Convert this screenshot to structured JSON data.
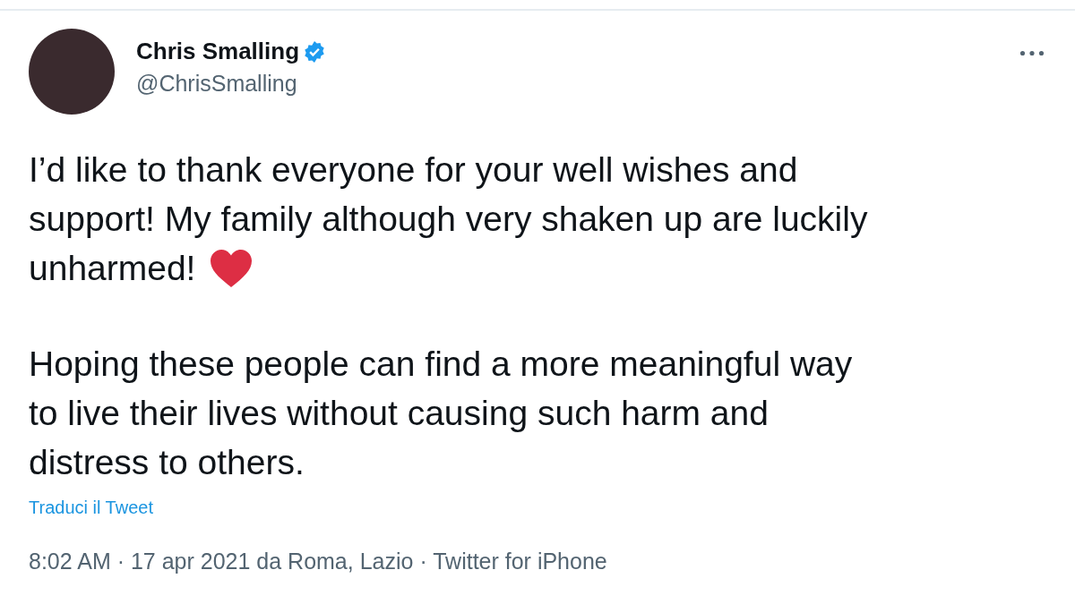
{
  "author": {
    "name": "Chris Smalling",
    "verified": true,
    "handle": "@ChrisSmalling"
  },
  "body": [
    {
      "lines": [
        "I’d like to thank everyone for your well wishes and",
        "support! My family although very shaken up are luckily",
        "unharmed!"
      ],
      "heart": true
    },
    {
      "lines": [
        "Hoping these people can find a more meaningful way",
        "to live their lives without causing such harm and",
        "distress to others."
      ],
      "heart": false
    }
  ],
  "translate_link": "Traduci il Tweet",
  "meta": "8:02 AM · 17 apr 2021 da Roma, Lazio · Twitter for iPhone"
}
